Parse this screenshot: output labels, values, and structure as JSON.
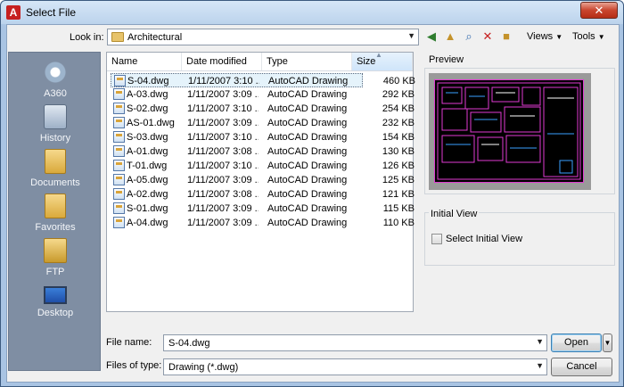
{
  "window": {
    "title": "Select File",
    "app_icon_letter": "A",
    "close_glyph": "✕"
  },
  "toolbar": {
    "look_in_label": "Look in:",
    "look_in_value": "Architectural",
    "icons": [
      "back-arrow-icon",
      "folder-up-icon",
      "search-web-icon",
      "delete-icon",
      "new-folder-icon"
    ],
    "views_label": "Views",
    "tools_label": "Tools",
    "dropdown_glyph": "▼"
  },
  "places": [
    {
      "label": "A360",
      "icon": "a360-icon"
    },
    {
      "label": "History",
      "icon": "history-icon"
    },
    {
      "label": "Documents",
      "icon": "documents-icon"
    },
    {
      "label": "Favorites",
      "icon": "favorites-icon"
    },
    {
      "label": "FTP",
      "icon": "ftp-icon"
    },
    {
      "label": "Desktop",
      "icon": "desktop-icon"
    }
  ],
  "file_list": {
    "columns": [
      "Name",
      "Date modified",
      "Type",
      "Size"
    ],
    "sort_glyph": "▲",
    "rows": [
      {
        "name": "S-04.dwg",
        "date": "1/11/2007 3:10 ...",
        "type": "AutoCAD Drawing",
        "size": "460 KB",
        "selected": true
      },
      {
        "name": "A-03.dwg",
        "date": "1/11/2007 3:09 ...",
        "type": "AutoCAD Drawing",
        "size": "292 KB"
      },
      {
        "name": "S-02.dwg",
        "date": "1/11/2007 3:10 ...",
        "type": "AutoCAD Drawing",
        "size": "254 KB"
      },
      {
        "name": "AS-01.dwg",
        "date": "1/11/2007 3:09 ...",
        "type": "AutoCAD Drawing",
        "size": "232 KB"
      },
      {
        "name": "S-03.dwg",
        "date": "1/11/2007 3:10 ...",
        "type": "AutoCAD Drawing",
        "size": "154 KB"
      },
      {
        "name": "A-01.dwg",
        "date": "1/11/2007 3:08 ...",
        "type": "AutoCAD Drawing",
        "size": "130 KB"
      },
      {
        "name": "T-01.dwg",
        "date": "1/11/2007 3:10 ...",
        "type": "AutoCAD Drawing",
        "size": "126 KB"
      },
      {
        "name": "A-05.dwg",
        "date": "1/11/2007 3:09 ...",
        "type": "AutoCAD Drawing",
        "size": "125 KB"
      },
      {
        "name": "A-02.dwg",
        "date": "1/11/2007 3:08 ...",
        "type": "AutoCAD Drawing",
        "size": "121 KB"
      },
      {
        "name": "S-01.dwg",
        "date": "1/11/2007 3:09 ...",
        "type": "AutoCAD Drawing",
        "size": "115 KB"
      },
      {
        "name": "A-04.dwg",
        "date": "1/11/2007 3:09 ...",
        "type": "AutoCAD Drawing",
        "size": "110 KB"
      }
    ]
  },
  "preview": {
    "label": "Preview"
  },
  "initial_view": {
    "label": "Initial View",
    "checkbox_label": "Select Initial View",
    "checked": false
  },
  "footer": {
    "file_name_label": "File name:",
    "file_name_value": "S-04.dwg",
    "file_type_label": "Files of type:",
    "file_type_value": "Drawing (*.dwg)",
    "open_label": "Open",
    "cancel_label": "Cancel"
  },
  "colors": {
    "selection": "#e5f3fb",
    "places_bg": "#7f8ea3",
    "preview_border": "#e03ad2"
  }
}
